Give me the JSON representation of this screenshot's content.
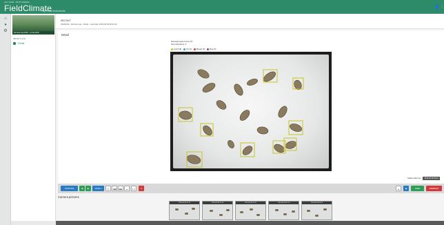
{
  "header": {
    "brand_small": "vom 14.06 · 15:47 Analytics",
    "brand": "FieldClimate",
    "brand_by": "by Pessl Instruments"
  },
  "sidebar": {
    "station_label": "Remote trap 2020 · 14-06-2018",
    "header": "iSCOUT (2.0)",
    "items": [
      {
        "label": "Detail"
      }
    ]
  },
  "breadcrumb": {
    "title": "iSCOUT",
    "subtitle": "0120024A · Remote trap · Detail · Last data: 2019-06-09 08:12:42"
  },
  "detail": {
    "title": "Detail",
    "detections_line1": "Detected pests found: 18",
    "detections_line2": "New detections: 4",
    "legend": [
      {
        "label": "Leaf (18)",
        "color": "#c6c423"
      },
      {
        "label": "Fly (0)",
        "color": "#2ea0e0"
      },
      {
        "label": "Beetle (0)",
        "color": "#d04040"
      },
      {
        "label": "Bug (0)",
        "color": "#7a4aa0"
      }
    ],
    "date_label": "Station data from:",
    "date_value": "2019-06-09 08:12"
  },
  "toolbar": {
    "station_btn": "STATIONS",
    "prev_label": "◀",
    "next_label": "▶",
    "date_btn": "DATE 1",
    "first": "⏮",
    "back": "◀◀",
    "fwd": "▶▶",
    "last": "⏭",
    "zoom": "1:1",
    "delete": "✕",
    "zoom_out": "▲",
    "info": "◉",
    "save": "SAVE",
    "refresh": "REFRESH"
  },
  "camera": {
    "title": "Camera pictures",
    "thumbs": [
      {
        "caption": "2019-06-08 20:17"
      },
      {
        "caption": "2019-06-08 21:30"
      },
      {
        "caption": "2019-06-08 22:21"
      },
      {
        "caption": "2019-06-09 02:14"
      },
      {
        "caption": "2019-06-09 08:12"
      }
    ]
  },
  "colors": {
    "brand": "#2e8b6a",
    "detect_box": "#c6c423",
    "btn_blue": "#2b7bc4",
    "btn_green": "#2e9e55",
    "btn_red": "#d03a3a"
  },
  "icons": {
    "rail": [
      "home-icon",
      "station-icon",
      "settings-icon"
    ],
    "top": [
      "user-icon",
      "more-icon"
    ]
  }
}
